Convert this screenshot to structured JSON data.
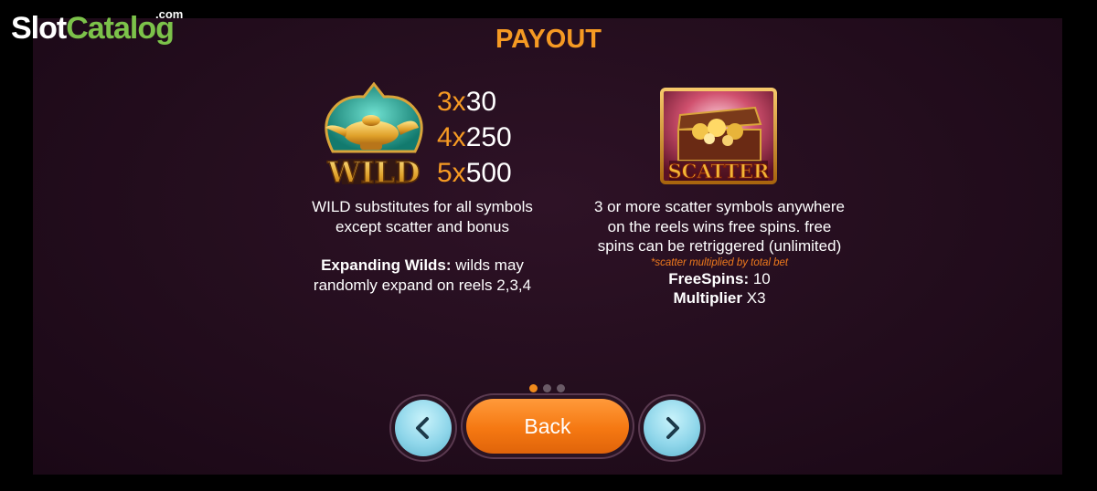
{
  "logo": {
    "slot": "Slot",
    "catalog": "Catalog",
    "com": ".com"
  },
  "title": "PAYOUT",
  "wild": {
    "icon": "wild-lamp-icon",
    "label": "WILD",
    "pays": [
      {
        "mult": "3x",
        "value": "30"
      },
      {
        "mult": "4x",
        "value": "250"
      },
      {
        "mult": "5x",
        "value": "500"
      }
    ],
    "line1": "WILD substitutes for all symbols",
    "line2": "except scatter and bonus",
    "expanding_label": "Expanding Wilds:",
    "expanding_text": " wilds may",
    "expanding_line2": "randomly expand on reels 2,3,4"
  },
  "scatter": {
    "icon": "scatter-treasure-chest-icon",
    "label": "SCATTER",
    "line1": "3 or more scatter symbols anywhere",
    "line2": "on the reels wins free spins. free",
    "line3": "spins can be retriggered (unlimited)",
    "note": "*scatter multiplied by total bet",
    "freespins_label": "FreeSpins:",
    "freespins_value": " 10",
    "multiplier_label": "Multiplier",
    "multiplier_value": " X3"
  },
  "pagination": {
    "total": 3,
    "active": 1
  },
  "buttons": {
    "back": "Back",
    "prev_icon": "chevron-left-icon",
    "next_icon": "chevron-right-icon"
  },
  "colors": {
    "accent": "#f59a23",
    "logo_green": "#7cc24a",
    "button_orange": "#f57812",
    "nav_blue": "#8fd6ea"
  }
}
